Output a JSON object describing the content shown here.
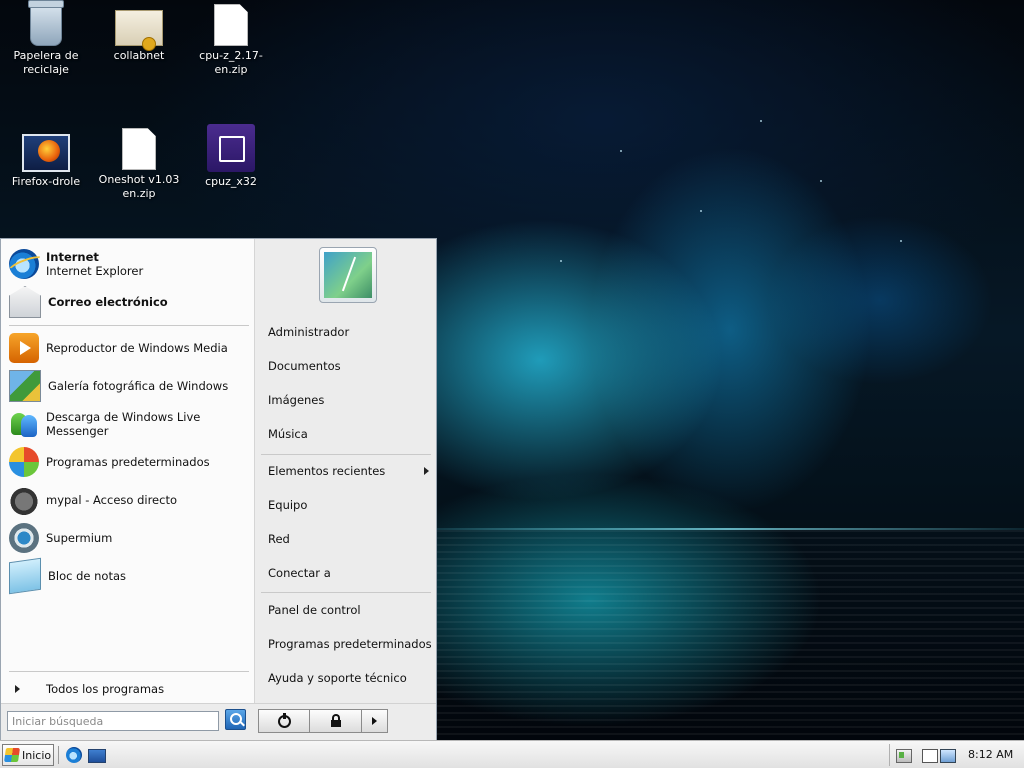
{
  "desktop": {
    "icons": [
      {
        "label": "Papelera de reciclaje"
      },
      {
        "label": "collabnet"
      },
      {
        "label": "cpu-z_2.17-en.zip"
      },
      {
        "label": "Firefox-drole"
      },
      {
        "label": "Oneshot v1.03 en.zip"
      },
      {
        "label": "cpuz_x32"
      }
    ]
  },
  "start_menu": {
    "pinned": [
      {
        "title": "Internet",
        "subtitle": "Internet Explorer",
        "icon": "ie-icon"
      },
      {
        "title": "Correo electrónico",
        "icon": "mail-icon"
      }
    ],
    "recent": [
      {
        "label": "Reproductor de Windows Media",
        "icon": "media-player-icon"
      },
      {
        "label": "Galería fotográfica de Windows",
        "icon": "photo-gallery-icon"
      },
      {
        "label": "Descarga de Windows Live Messenger",
        "icon": "messenger-icon"
      },
      {
        "label": "Programas predeterminados",
        "icon": "default-programs-icon"
      },
      {
        "label": "mypal - Acceso directo",
        "icon": "raccoon-icon"
      },
      {
        "label": "Supermium",
        "icon": "supermium-icon"
      },
      {
        "label": "Bloc de notas",
        "icon": "notepad-icon"
      }
    ],
    "all_programs": "Todos los programas",
    "right": {
      "group1": [
        "Administrador",
        "Documentos",
        "Imágenes",
        "Música"
      ],
      "group2": [
        "Elementos recientes",
        "Equipo",
        "Red",
        "Conectar a"
      ],
      "group3": [
        "Panel de control",
        "Programas predeterminados",
        "Ayuda y soporte técnico"
      ]
    },
    "search_placeholder": "Iniciar búsqueda"
  },
  "taskbar": {
    "start_label": "Inicio",
    "clock": "8:12 AM"
  }
}
